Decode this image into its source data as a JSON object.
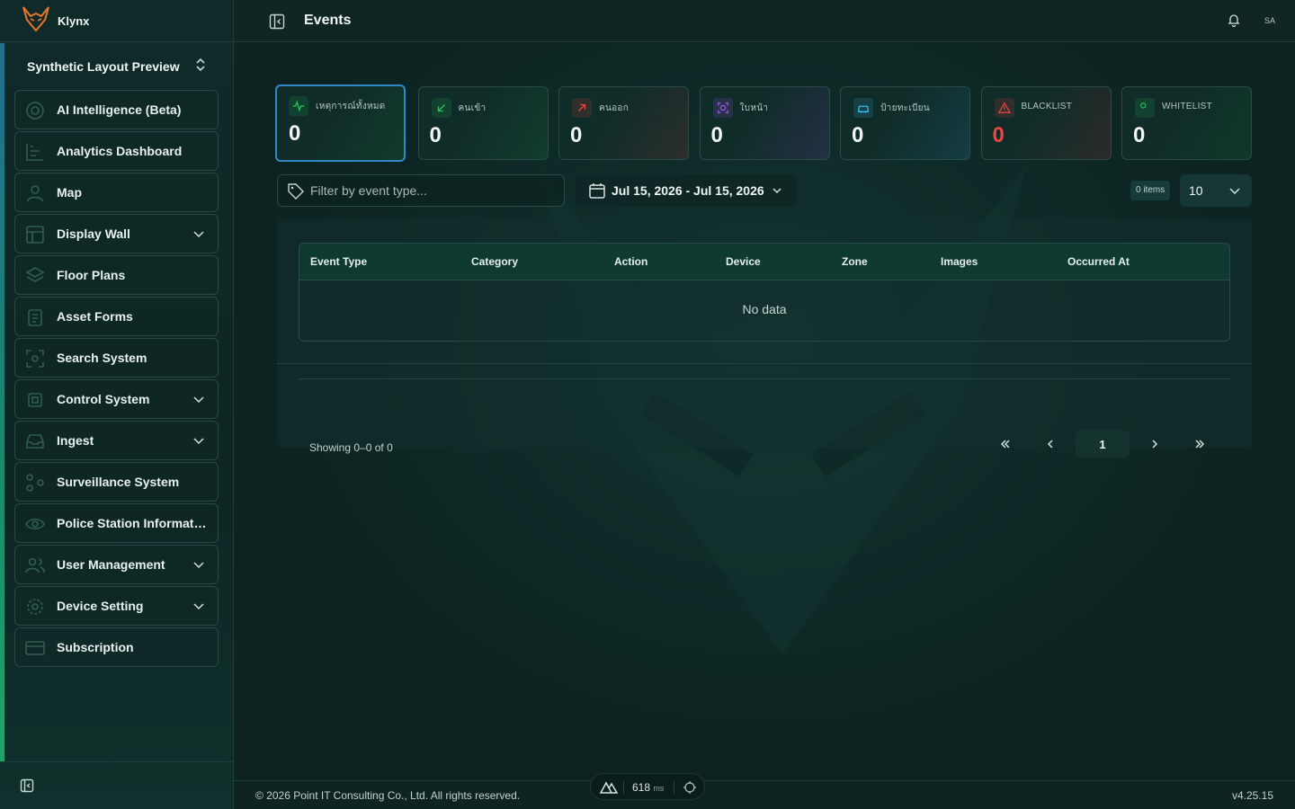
{
  "brand": {
    "name": "Klynx"
  },
  "workspace": {
    "label": "Synthetic Layout Preview"
  },
  "sidebar": {
    "items": [
      {
        "label": "AI Intelligence (Beta)",
        "icon": "brain-icon",
        "expandable": false
      },
      {
        "label": "Analytics Dashboard",
        "icon": "chart-icon",
        "expandable": false
      },
      {
        "label": "Map",
        "icon": "user-pin-icon",
        "expandable": false
      },
      {
        "label": "Display Wall",
        "icon": "layout-icon",
        "expandable": true
      },
      {
        "label": "Floor Plans",
        "icon": "layers-icon",
        "expandable": false
      },
      {
        "label": "Asset Forms",
        "icon": "clipboard-icon",
        "expandable": false
      },
      {
        "label": "Search System",
        "icon": "scan-icon",
        "expandable": false
      },
      {
        "label": "Control System",
        "icon": "cpu-icon",
        "expandable": true
      },
      {
        "label": "Ingest",
        "icon": "inbox-icon",
        "expandable": true
      },
      {
        "label": "Surveillance System",
        "icon": "network-icon",
        "expandable": false
      },
      {
        "label": "Police Station Informati...",
        "icon": "eye-icon",
        "expandable": false
      },
      {
        "label": "User Management",
        "icon": "users-icon",
        "expandable": true
      },
      {
        "label": "Device Setting",
        "icon": "gear-icon",
        "expandable": true
      },
      {
        "label": "Subscription",
        "icon": "card-icon",
        "expandable": false
      }
    ]
  },
  "header": {
    "title": "Events",
    "avatar": "SA"
  },
  "stats": [
    {
      "label": "เหตุการณ์ทั้งหมด",
      "value": "0",
      "icon": "activity-icon",
      "color": "#22c55e",
      "active": true
    },
    {
      "label": "คนเข้า",
      "value": "0",
      "icon": "arrow-down-left-icon",
      "color": "#22c55e",
      "active": false
    },
    {
      "label": "คนออก",
      "value": "0",
      "icon": "arrow-up-right-icon",
      "color": "#ef4444",
      "active": false
    },
    {
      "label": "ใบหน้า",
      "value": "0",
      "icon": "face-scan-icon",
      "color": "#a855f7",
      "active": false
    },
    {
      "label": "ป้ายทะเบียน",
      "value": "0",
      "icon": "car-icon",
      "color": "#38bdf8",
      "active": false
    },
    {
      "label": "BLACKLIST",
      "value": "0",
      "icon": "warning-icon",
      "color": "#ef4444",
      "active": false
    },
    {
      "label": "WHITELIST",
      "value": "0",
      "icon": "user-check-icon",
      "color": "#22c55e",
      "active": false
    }
  ],
  "filter": {
    "placeholder": "Filter by event type..."
  },
  "date_range": {
    "label": "Jul 15, 2026 - Jul 15, 2026"
  },
  "items_count": "0 items",
  "page_size": "10",
  "table": {
    "columns": [
      "Event Type",
      "Category",
      "Action",
      "Device",
      "Zone",
      "Images",
      "Occurred At"
    ],
    "empty_text": "No data"
  },
  "pagination": {
    "showing": "Showing 0–0 of 0",
    "current_page": "1"
  },
  "footer": {
    "copyright": "© 2026 Point IT Consulting Co., Ltd. All rights reserved.",
    "version": "v4.25.15"
  },
  "perf": {
    "value": "618",
    "unit": "ms"
  }
}
